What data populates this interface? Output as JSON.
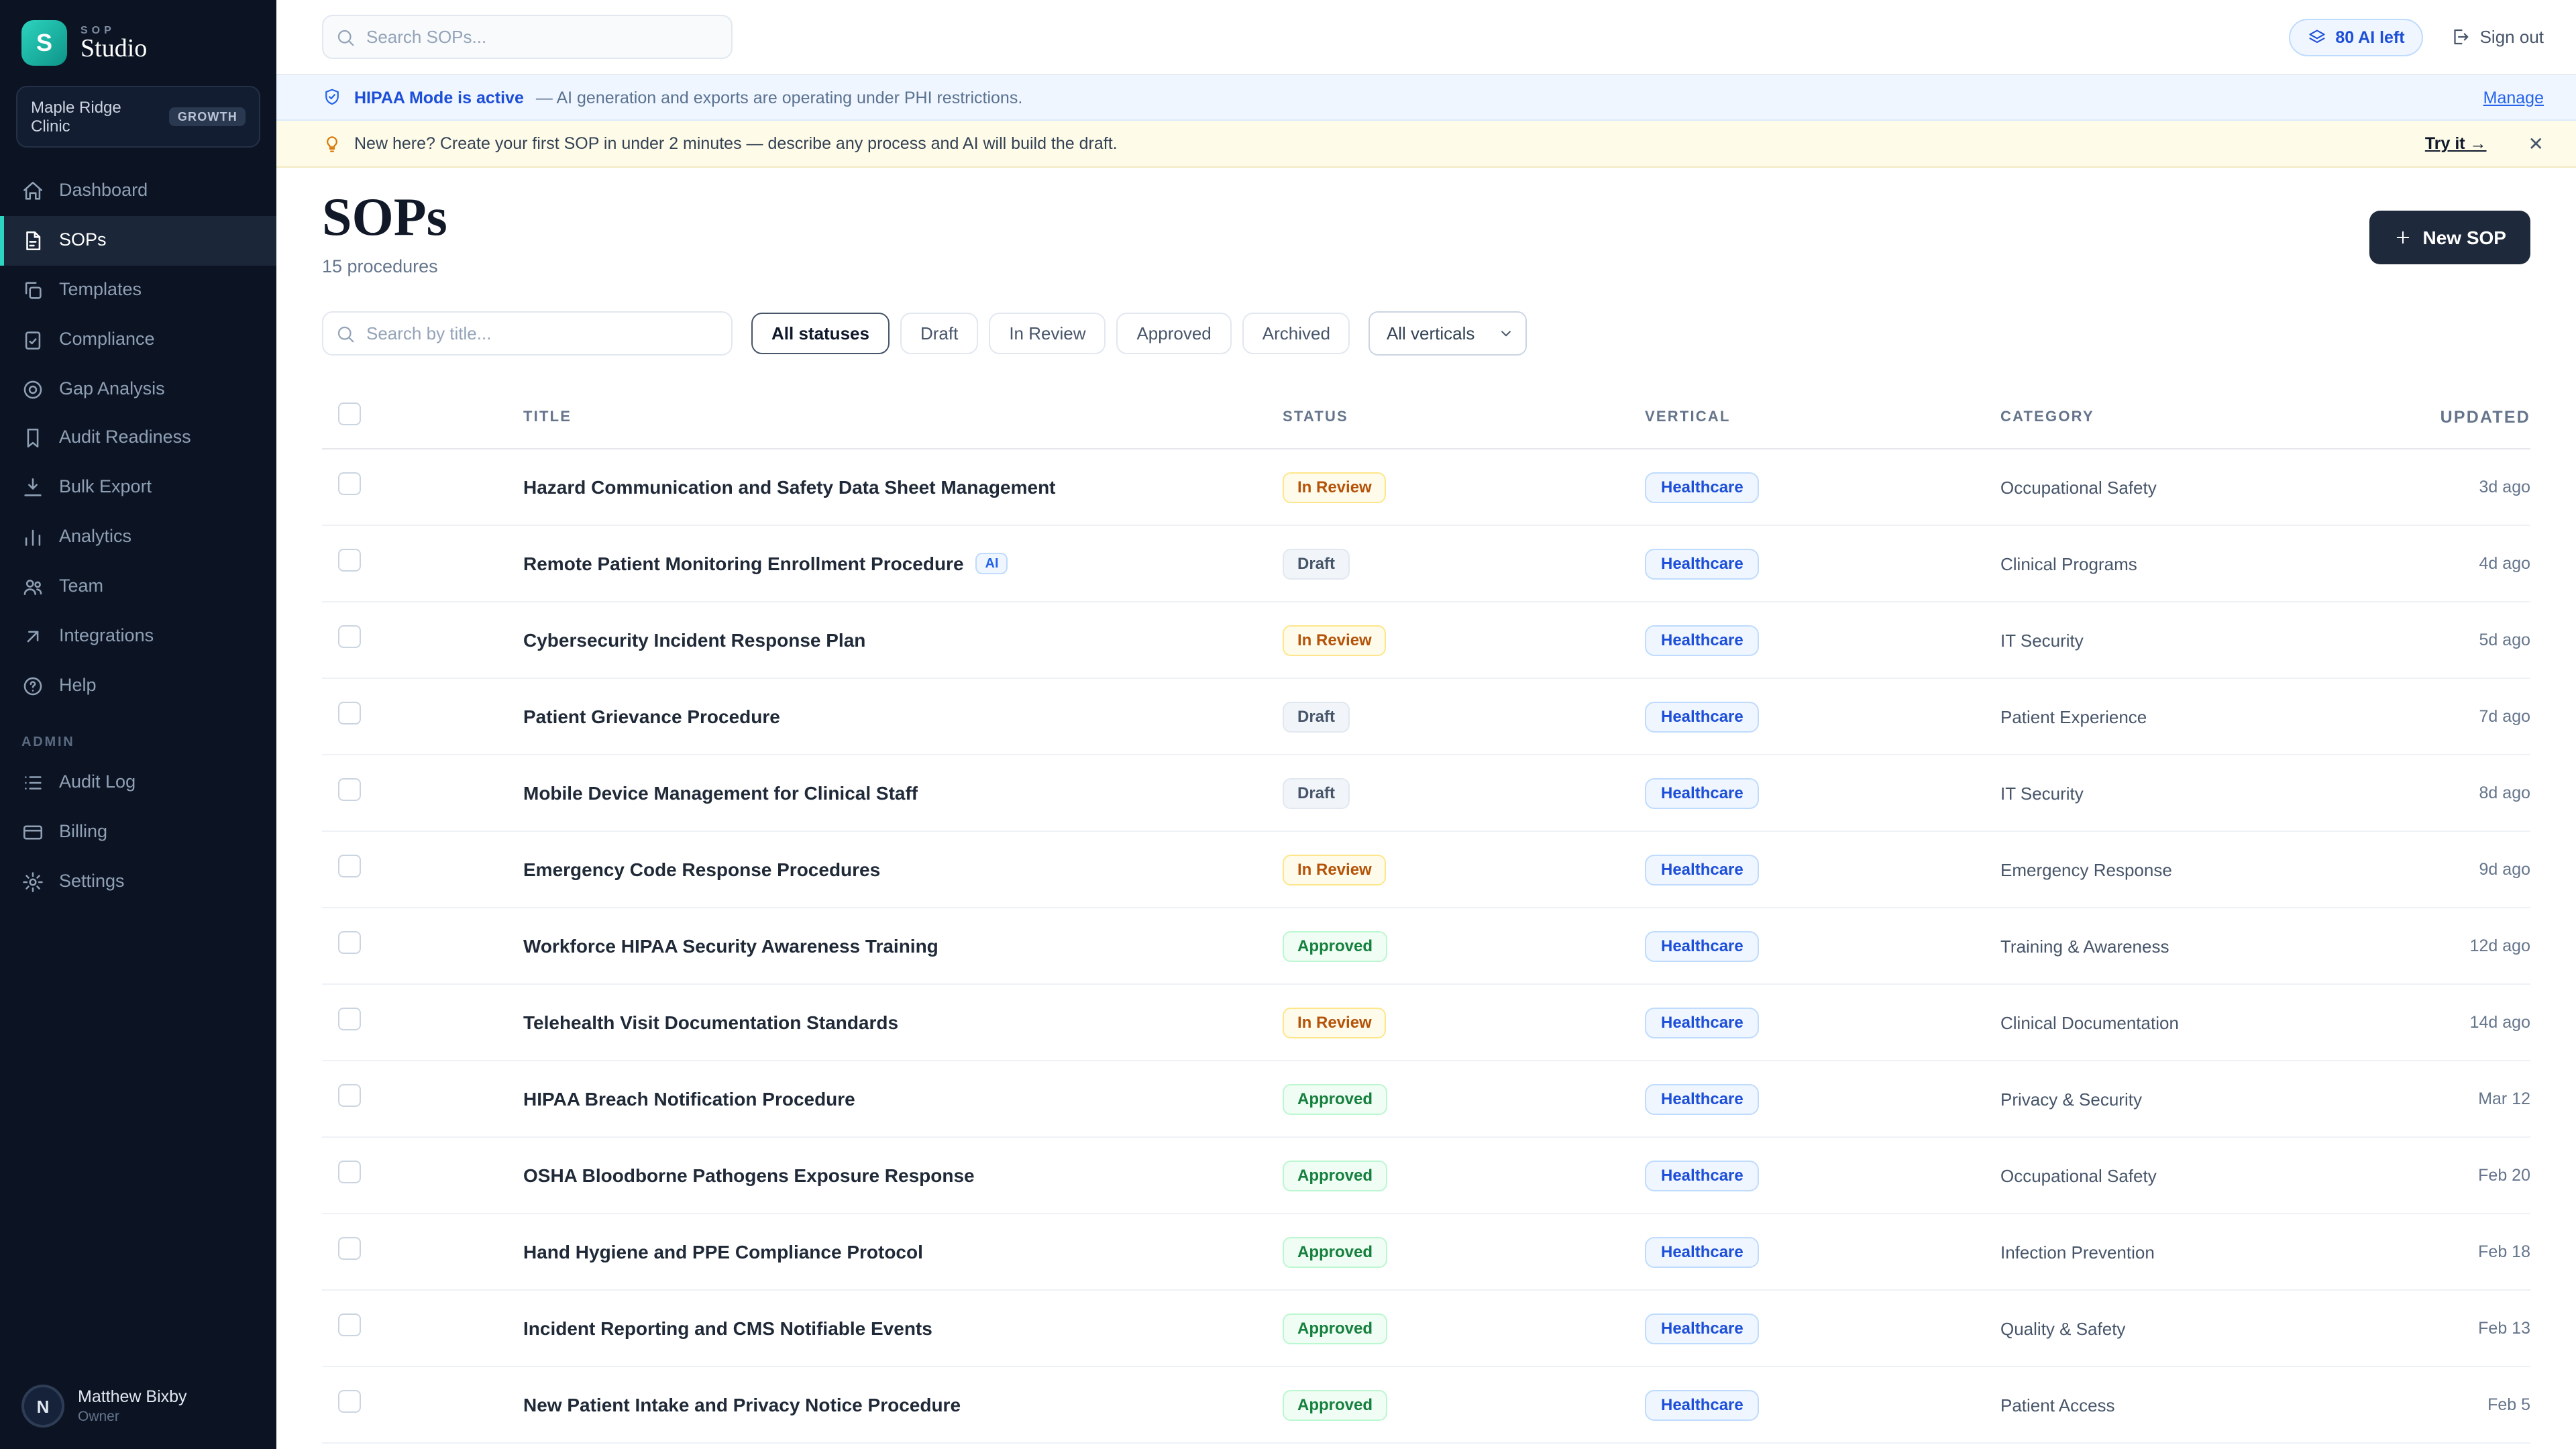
{
  "app": {
    "brand_top": "SOP",
    "brand_name": "Studio",
    "logo_letter": "S"
  },
  "workspace": {
    "name": "Maple Ridge Clinic",
    "plan": "GROWTH"
  },
  "sidebar": {
    "items": [
      {
        "label": "Dashboard",
        "icon": "home"
      },
      {
        "label": "SOPs",
        "icon": "file",
        "active": true
      },
      {
        "label": "Templates",
        "icon": "copy"
      },
      {
        "label": "Compliance",
        "icon": "clipboard"
      },
      {
        "label": "Gap Analysis",
        "icon": "target"
      },
      {
        "label": "Audit Readiness",
        "icon": "bookmark"
      },
      {
        "label": "Bulk Export",
        "icon": "download"
      },
      {
        "label": "Analytics",
        "icon": "chart"
      },
      {
        "label": "Team",
        "icon": "users"
      },
      {
        "label": "Integrations",
        "icon": "plug"
      },
      {
        "label": "Help",
        "icon": "help"
      }
    ],
    "admin_label": "ADMIN",
    "admin_items": [
      {
        "label": "Audit Log",
        "icon": "list"
      },
      {
        "label": "Billing",
        "icon": "card"
      },
      {
        "label": "Settings",
        "icon": "gear"
      }
    ],
    "user": {
      "initial": "N",
      "name": "Matthew Bixby",
      "role": "Owner"
    }
  },
  "topbar": {
    "search_placeholder": "Search SOPs...",
    "ai_credits": "80 AI left",
    "sign_out": "Sign out"
  },
  "banners": {
    "hipaa": {
      "title": "HIPAA Mode is active",
      "text": "— AI generation and exports are operating under PHI restrictions.",
      "action": "Manage"
    },
    "tip": {
      "text": "New here? Create your first SOP in under 2 minutes — describe any process and AI will build the draft.",
      "action": "Try it →",
      "close": "✕"
    }
  },
  "page": {
    "title": "SOPs",
    "subtitle": "15 procedures",
    "new_button": "New SOP"
  },
  "filters": {
    "search_placeholder": "Search by title...",
    "statuses": [
      "All statuses",
      "Draft",
      "In Review",
      "Approved",
      "Archived"
    ],
    "active_status": "All statuses",
    "verticals_value": "All verticals"
  },
  "table": {
    "columns": [
      "TITLE",
      "STATUS",
      "VERTICAL",
      "CATEGORY",
      "UPDATED"
    ],
    "ai_badge_label": "AI",
    "rows": [
      {
        "title": "Hazard Communication and Safety Data Sheet Management",
        "ai": false,
        "status": "In Review",
        "vertical": "Healthcare",
        "category": "Occupational Safety",
        "updated": "3d ago"
      },
      {
        "title": "Remote Patient Monitoring Enrollment Procedure",
        "ai": true,
        "status": "Draft",
        "vertical": "Healthcare",
        "category": "Clinical Programs",
        "updated": "4d ago"
      },
      {
        "title": "Cybersecurity Incident Response Plan",
        "ai": false,
        "status": "In Review",
        "vertical": "Healthcare",
        "category": "IT Security",
        "updated": "5d ago"
      },
      {
        "title": "Patient Grievance Procedure",
        "ai": false,
        "status": "Draft",
        "vertical": "Healthcare",
        "category": "Patient Experience",
        "updated": "7d ago"
      },
      {
        "title": "Mobile Device Management for Clinical Staff",
        "ai": false,
        "status": "Draft",
        "vertical": "Healthcare",
        "category": "IT Security",
        "updated": "8d ago"
      },
      {
        "title": "Emergency Code Response Procedures",
        "ai": false,
        "status": "In Review",
        "vertical": "Healthcare",
        "category": "Emergency Response",
        "updated": "9d ago"
      },
      {
        "title": "Workforce HIPAA Security Awareness Training",
        "ai": false,
        "status": "Approved",
        "vertical": "Healthcare",
        "category": "Training & Awareness",
        "updated": "12d ago"
      },
      {
        "title": "Telehealth Visit Documentation Standards",
        "ai": false,
        "status": "In Review",
        "vertical": "Healthcare",
        "category": "Clinical Documentation",
        "updated": "14d ago"
      },
      {
        "title": "HIPAA Breach Notification Procedure",
        "ai": false,
        "status": "Approved",
        "vertical": "Healthcare",
        "category": "Privacy & Security",
        "updated": "Mar 12"
      },
      {
        "title": "OSHA Bloodborne Pathogens Exposure Response",
        "ai": false,
        "status": "Approved",
        "vertical": "Healthcare",
        "category": "Occupational Safety",
        "updated": "Feb 20"
      },
      {
        "title": "Hand Hygiene and PPE Compliance Protocol",
        "ai": false,
        "status": "Approved",
        "vertical": "Healthcare",
        "category": "Infection Prevention",
        "updated": "Feb 18"
      },
      {
        "title": "Incident Reporting and CMS Notifiable Events",
        "ai": false,
        "status": "Approved",
        "vertical": "Healthcare",
        "category": "Quality & Safety",
        "updated": "Feb 13"
      },
      {
        "title": "New Patient Intake and Privacy Notice Procedure",
        "ai": false,
        "status": "Approved",
        "vertical": "Healthcare",
        "category": "Patient Access",
        "updated": "Feb 5"
      }
    ]
  }
}
